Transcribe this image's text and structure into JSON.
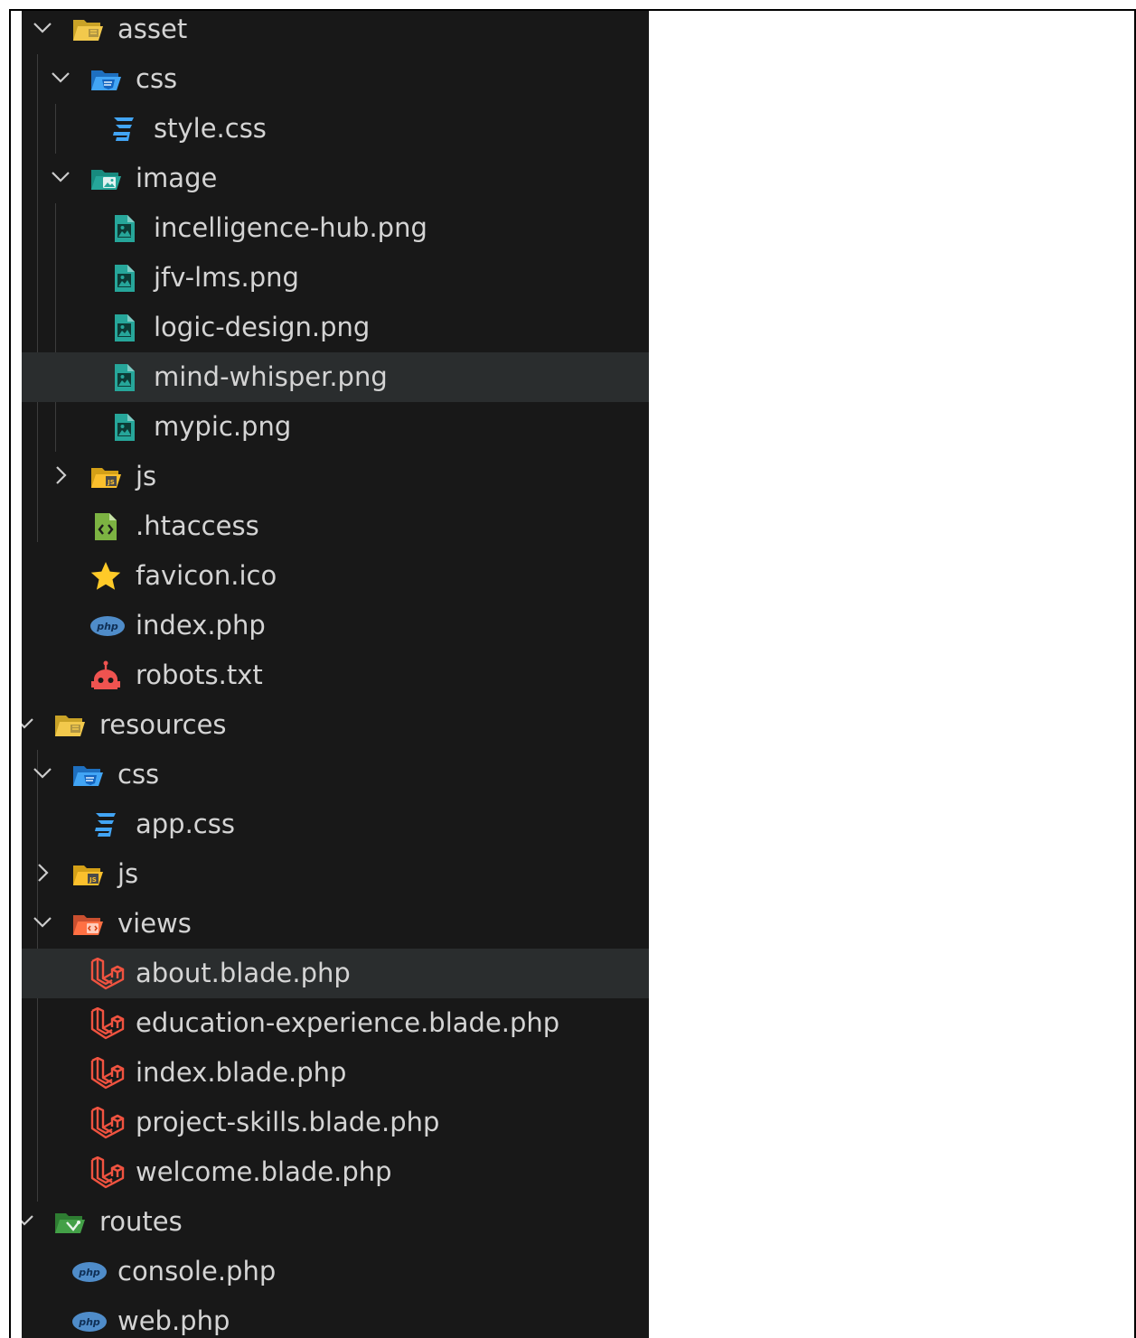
{
  "explorer": {
    "items": [
      {
        "label": "asset",
        "icon": "folder-open-icon",
        "expanded": true,
        "depth": 1
      },
      {
        "label": "css",
        "icon": "folder-css-icon",
        "expanded": true,
        "depth": 2
      },
      {
        "label": "style.css",
        "icon": "css-file-icon",
        "depth": 3
      },
      {
        "label": "image",
        "icon": "folder-image-icon",
        "expanded": true,
        "depth": 2
      },
      {
        "label": "incelligence-hub.png",
        "icon": "image-file-icon",
        "depth": 3
      },
      {
        "label": "jfv-lms.png",
        "icon": "image-file-icon",
        "depth": 3
      },
      {
        "label": "logic-design.png",
        "icon": "image-file-icon",
        "depth": 3
      },
      {
        "label": "mind-whisper.png",
        "icon": "image-file-icon",
        "depth": 3,
        "selected": true
      },
      {
        "label": "mypic.png",
        "icon": "image-file-icon",
        "depth": 3
      },
      {
        "label": "js",
        "icon": "folder-js-icon",
        "expanded": false,
        "depth": 2
      },
      {
        "label": ".htaccess",
        "icon": "htaccess-file-icon",
        "depth": 2
      },
      {
        "label": "favicon.ico",
        "icon": "star-icon",
        "depth": 2
      },
      {
        "label": "index.php",
        "icon": "php-icon",
        "depth": 2
      },
      {
        "label": "robots.txt",
        "icon": "robot-icon",
        "depth": 2
      },
      {
        "label": "resources",
        "icon": "folder-open-icon",
        "expanded": true,
        "depth": 0
      },
      {
        "label": "css",
        "icon": "folder-css-icon",
        "expanded": true,
        "depth": 1
      },
      {
        "label": "app.css",
        "icon": "css-file-icon",
        "depth": 2
      },
      {
        "label": "js",
        "icon": "folder-js-icon",
        "expanded": false,
        "depth": 1
      },
      {
        "label": "views",
        "icon": "folder-views-icon",
        "expanded": true,
        "depth": 1
      },
      {
        "label": "about.blade.php",
        "icon": "laravel-icon",
        "depth": 2,
        "selected": true
      },
      {
        "label": "education-experience.blade.php",
        "icon": "laravel-icon",
        "depth": 2
      },
      {
        "label": "index.blade.php",
        "icon": "laravel-icon",
        "depth": 2
      },
      {
        "label": "project-skills.blade.php",
        "icon": "laravel-icon",
        "depth": 2
      },
      {
        "label": "welcome.blade.php",
        "icon": "laravel-icon",
        "depth": 2
      },
      {
        "label": "routes",
        "icon": "folder-routes-icon",
        "expanded": true,
        "depth": 0
      },
      {
        "label": "console.php",
        "icon": "php-icon",
        "depth": 1
      },
      {
        "label": "web.php",
        "icon": "php-icon",
        "depth": 1
      }
    ]
  },
  "colors": {
    "background": "#181818",
    "selected": "#2a2d2e",
    "text": "#d4d4d4",
    "css_blue": "#42a5f5",
    "image_teal": "#26a69a",
    "js_yellow": "#fbc02d",
    "laravel_red": "#f05340",
    "php_blue": "#4f8cc9"
  }
}
